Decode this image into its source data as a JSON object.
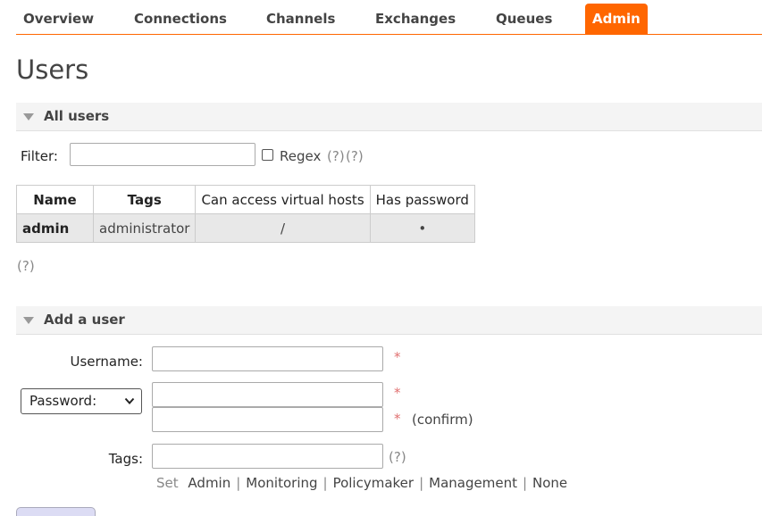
{
  "nav": {
    "items": [
      {
        "label": "Overview"
      },
      {
        "label": "Connections"
      },
      {
        "label": "Channels"
      },
      {
        "label": "Exchanges"
      },
      {
        "label": "Queues"
      },
      {
        "label": "Admin",
        "active": true
      }
    ],
    "accent_color": "#ff6600"
  },
  "page_title": "Users",
  "all_users": {
    "title": "All users",
    "filter": {
      "label": "Filter:",
      "value": "",
      "regex_label": "Regex",
      "regex_checked": false,
      "help1": "(?)",
      "help2": "(?)"
    },
    "table": {
      "columns": [
        "Name",
        "Tags",
        "Can access virtual hosts",
        "Has password"
      ],
      "rows": [
        {
          "name": "admin",
          "tags": "administrator",
          "vhosts": "/",
          "has_password": "•"
        }
      ]
    },
    "help": "(?)"
  },
  "add_user": {
    "title": "Add a user",
    "username_label": "Username:",
    "username_value": "",
    "password_select": "Password:",
    "password_value": "",
    "confirm_value": "",
    "confirm_label": "(confirm)",
    "required_mark": "*",
    "tags_label": "Tags:",
    "tags_value": "",
    "tags_help": "(?)",
    "set_label": "Set",
    "tag_options": [
      "Admin",
      "Monitoring",
      "Policymaker",
      "Management",
      "None"
    ],
    "separator": "|"
  }
}
